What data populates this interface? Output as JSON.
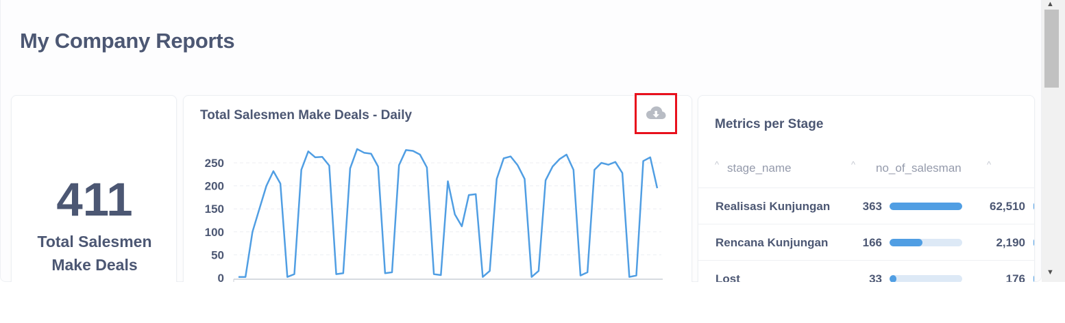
{
  "page": {
    "title": "My Company Reports"
  },
  "kpi": {
    "value": "411",
    "label": "Total Salesmen Make Deals"
  },
  "line_card": {
    "title": "Total Salesmen Make Deals - Daily",
    "download_icon": "cloud-download-icon"
  },
  "chart_data": {
    "type": "line",
    "title": "Total Salesmen Make Deals - Daily",
    "xlabel": "",
    "ylabel": "",
    "ylim": [
      0,
      250
    ],
    "yticks": [
      "0",
      "50",
      "100",
      "150",
      "200",
      "250"
    ],
    "grid": true,
    "color": "#509ee3",
    "series": [
      {
        "values": [
          2,
          2,
          100,
          150,
          200,
          232,
          205,
          2,
          8,
          235,
          275,
          262,
          263,
          244,
          8,
          10,
          238,
          280,
          272,
          270,
          242,
          10,
          12,
          245,
          278,
          276,
          268,
          240,
          8,
          6,
          210,
          138,
          112,
          180,
          182,
          2,
          15,
          215,
          260,
          264,
          245,
          215,
          2,
          15,
          212,
          242,
          258,
          268,
          235,
          5,
          12,
          235,
          250,
          246,
          252,
          228,
          2,
          5,
          254,
          262,
          195
        ]
      }
    ]
  },
  "table_card": {
    "title": "Metrics per Stage",
    "columns": [
      "stage_name",
      "no_of_salesman"
    ],
    "rows": [
      {
        "stage_name": "Realisasi Kunjungan",
        "no_of_salesman": "363",
        "bar_fraction": 1.0,
        "extra": "62,510"
      },
      {
        "stage_name": "Rencana Kunjungan",
        "no_of_salesman": "166",
        "bar_fraction": 0.457,
        "extra": "2,190"
      },
      {
        "stage_name": "Lost",
        "no_of_salesman": "33",
        "bar_fraction": 0.091,
        "extra": "176"
      }
    ]
  },
  "colors": {
    "accent": "#509ee3",
    "text": "#4c5773",
    "highlight_border": "#e8101c"
  }
}
